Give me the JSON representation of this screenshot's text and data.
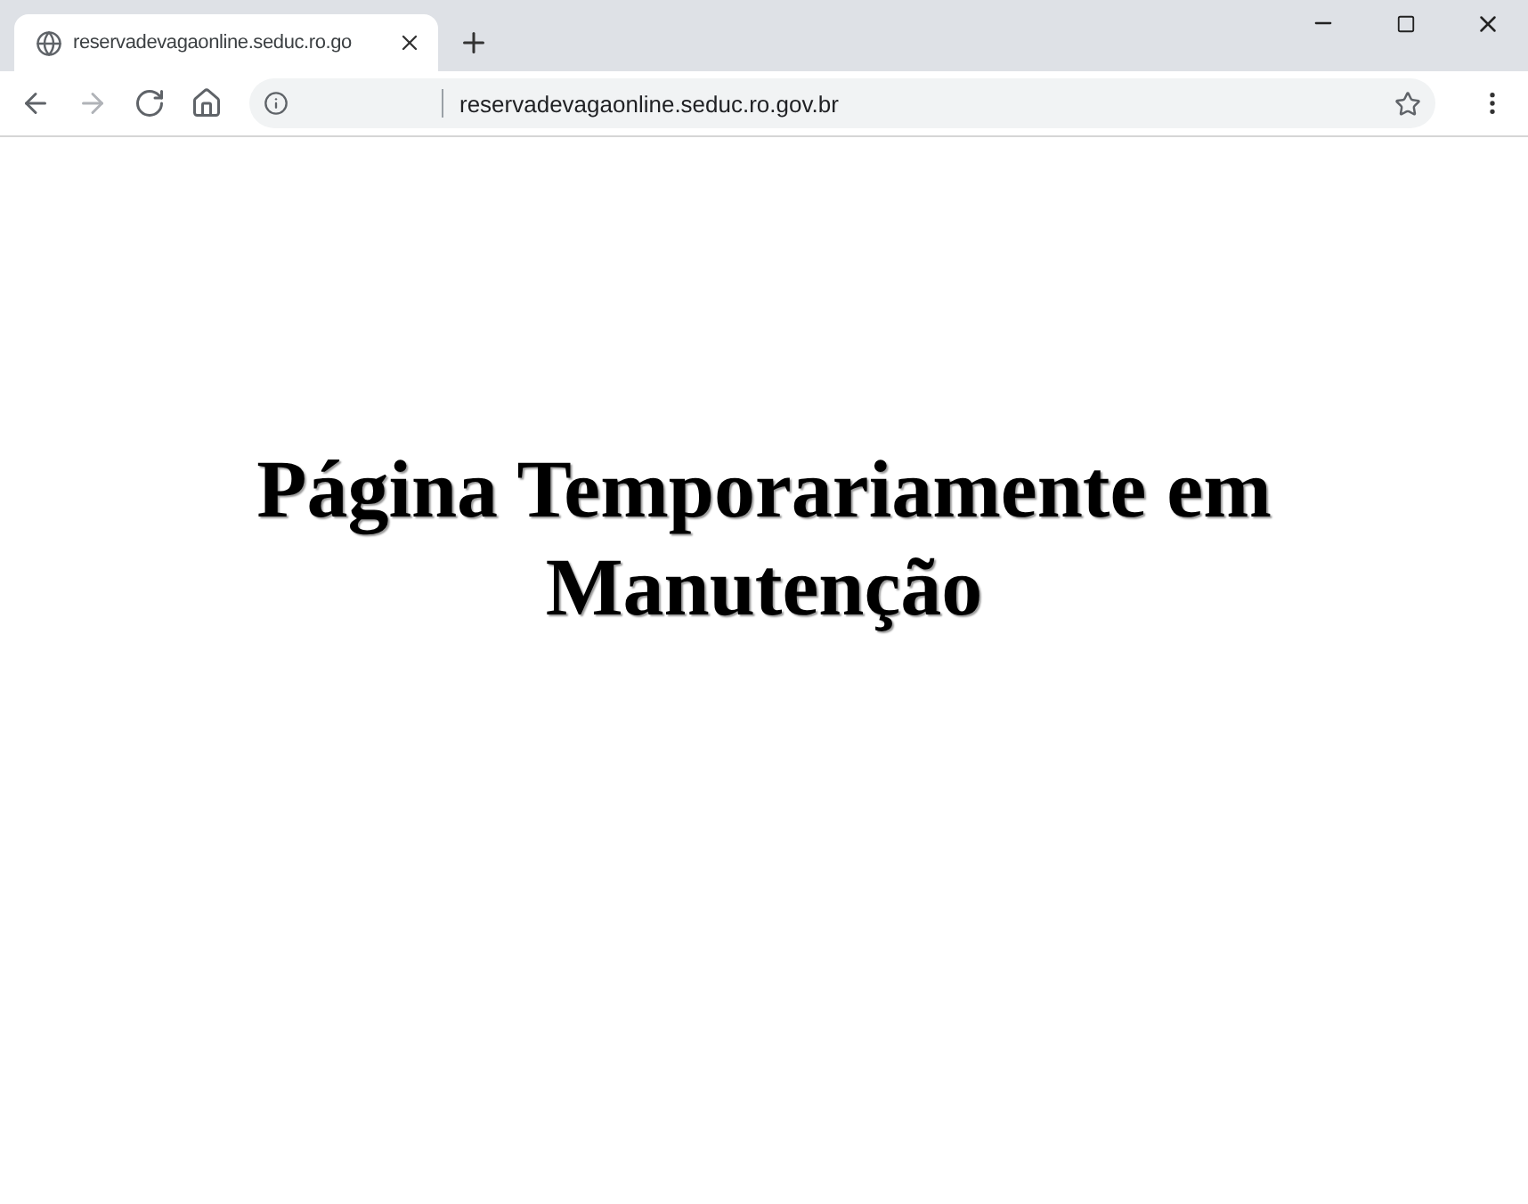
{
  "tab": {
    "title": "reservadevagaonline.seduc.ro.go",
    "selected": true
  },
  "nav_buttons": [
    {
      "kind": "back",
      "disabled": false
    },
    {
      "kind": "forward",
      "disabled": true
    },
    {
      "kind": "reload",
      "disabled": false
    },
    {
      "kind": "home",
      "disabled": false
    }
  ],
  "address_bar": {
    "url": "reservadevagaonline.seduc.ro.gov.br"
  },
  "page": {
    "heading": "Página Temporariamente em Manutenção"
  }
}
